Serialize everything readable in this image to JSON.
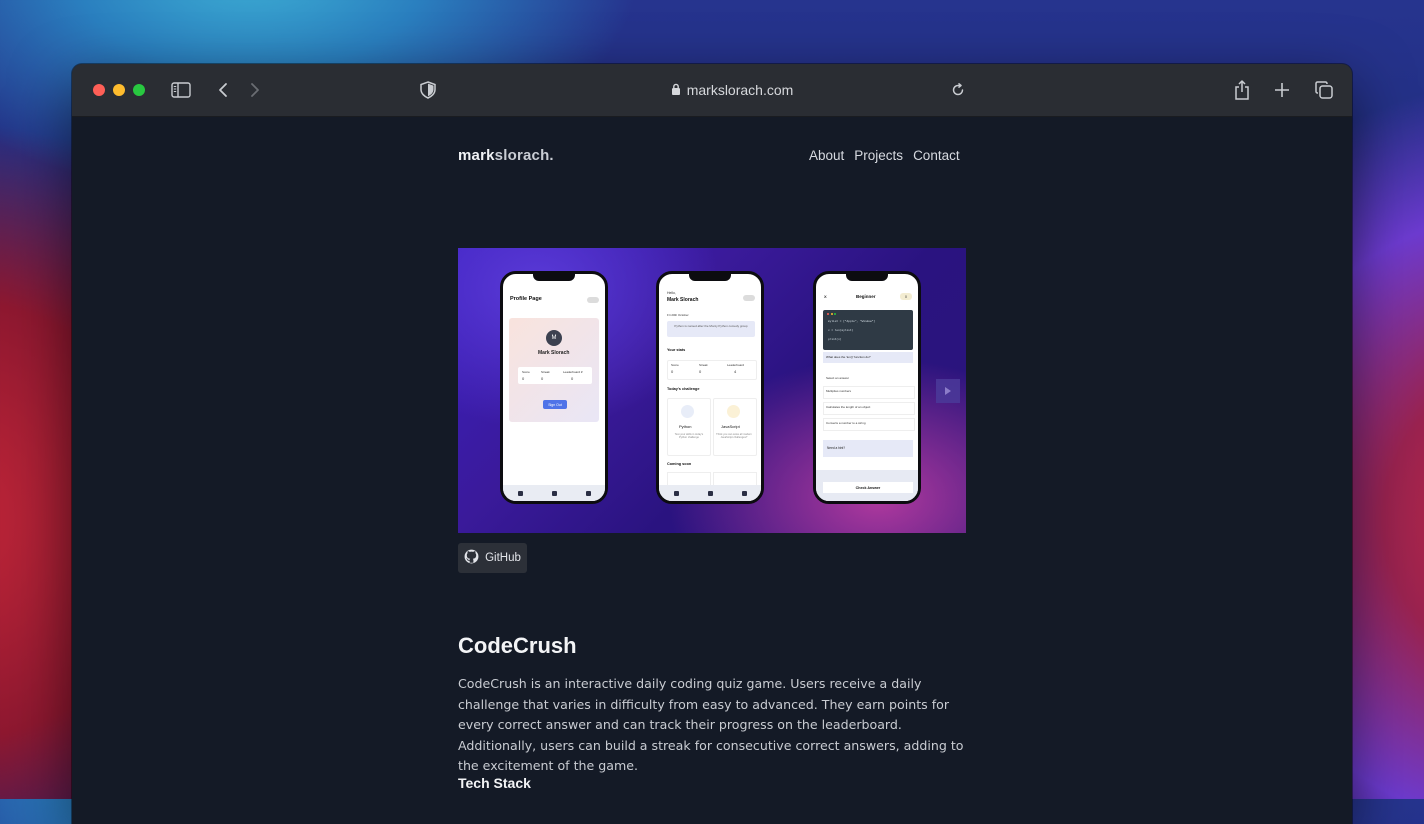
{
  "browser": {
    "url": "markslorach.com"
  },
  "site": {
    "logo_bold": "mark",
    "logo_light": "slorach.",
    "nav": [
      "About",
      "Projects",
      "Contact"
    ]
  },
  "hero": {
    "phone1": {
      "title": "Profile Page",
      "avatar_letter": "M",
      "name": "Mark Slorach",
      "stats": [
        "Score",
        "Streak",
        "Leaderboard #"
      ],
      "stat_values": [
        "0",
        "0",
        "0"
      ],
      "signout": "Sign Out"
    },
    "phone2": {
      "greeting": "Hello,",
      "name": "Mark Slorach",
      "date": "Fri 20th October",
      "fact": "Python is named after the Monty Python comedy group",
      "stats_title": "Your stats",
      "stats": [
        "Score",
        "Streak",
        "Leaderboard"
      ],
      "stat_values": [
        "0",
        "0",
        "4"
      ],
      "challenge_title": "Today's challenge",
      "card1": "Python",
      "card1_sub": "Test your skills in today's Python challenge",
      "card2": "JavaScript",
      "card2_sub": "Think you can solve all modern JavaScript challenges?",
      "coming": "Coming soon"
    },
    "phone3": {
      "close": "X",
      "level": "Beginner",
      "level_badge": "0",
      "code_lines": [
        "mylist = [\"Apple\", \"Window\"]",
        "x = len(mylist)",
        "print(x)"
      ],
      "question": "What does the 'len()' function do?",
      "select": "Select an answer",
      "answers": [
        "Multiplies numbers",
        "Calculates the length of an object",
        "Converts a number to a string"
      ],
      "hint": "Need a hint?",
      "check": "Check Answer"
    }
  },
  "github_label": "GitHub",
  "project": {
    "title": "CodeCrush",
    "description": "CodeCrush is an interactive daily coding quiz game. Users receive a daily challenge that varies in difficulty from easy to advanced. They earn points for every correct answer and can track their progress on the leaderboard. Additionally, users can build a streak for consecutive correct answers, adding to the excitement of the game.",
    "tech_heading": "Tech Stack"
  }
}
